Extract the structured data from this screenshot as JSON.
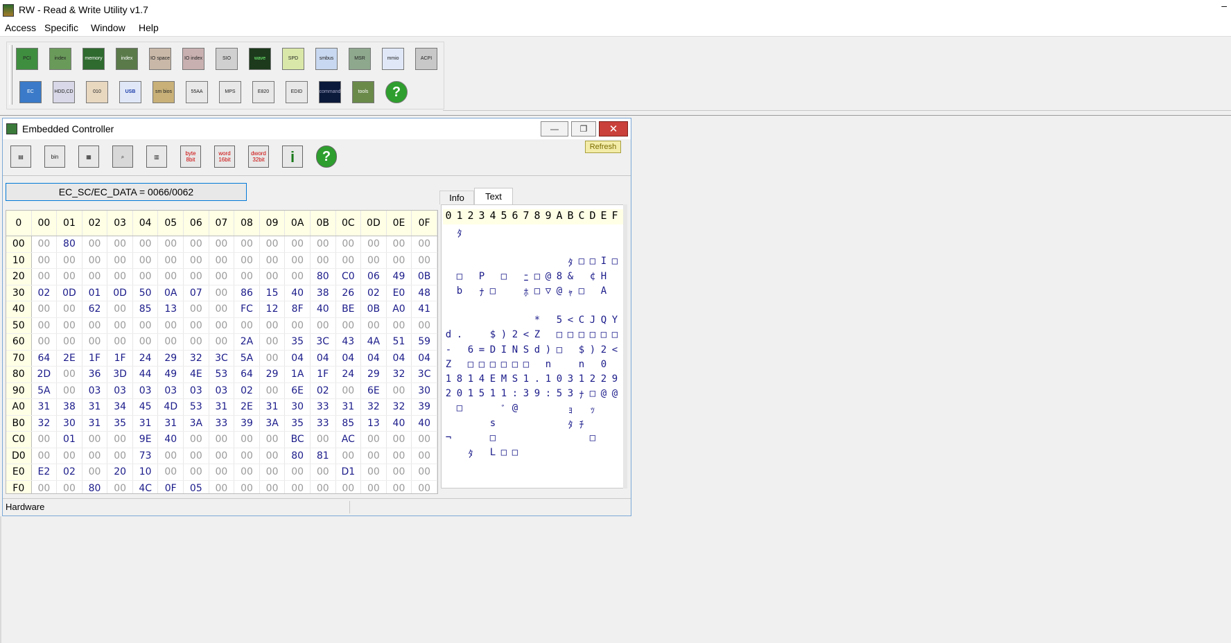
{
  "app": {
    "title": "RW - Read & Write Utility v1.7",
    "minimize_glyph": "–"
  },
  "menu": [
    "Access",
    "Specific",
    "Window",
    "Help"
  ],
  "toolbar": {
    "row1": [
      "PCI",
      "index",
      "memory",
      "index",
      "IO space",
      "IO index",
      "SIO",
      "wave",
      "SPD",
      "smbus",
      "MSR",
      "mmio",
      "ACPI"
    ],
    "row2": [
      "EC",
      "HDD,CD",
      "010",
      "USB",
      "sm bios",
      "55AA",
      "MPS",
      "E820",
      "EDID",
      "command",
      "tools",
      "help"
    ]
  },
  "ec_window": {
    "title": "Embedded Controller",
    "buttons": {
      "minimize": "—",
      "restore": "❐",
      "close": "✕"
    },
    "toolbar": [
      "save",
      "bin",
      "load",
      "find",
      "compare",
      "byte 8bit",
      "word 16bit",
      "dword 32bit",
      "info",
      "help"
    ],
    "refresh_label": "Refresh",
    "port_label": "EC_SC/EC_DATA = 0066/0062",
    "tabs": [
      "Info",
      "Text"
    ],
    "status_text": "Hardware",
    "hex": {
      "corner": "0",
      "columns": [
        "00",
        "01",
        "02",
        "03",
        "04",
        "05",
        "06",
        "07",
        "08",
        "09",
        "0A",
        "0B",
        "0C",
        "0D",
        "0E",
        "0F"
      ],
      "rows": [
        {
          "addr": "00",
          "cells": [
            "00",
            "80",
            "00",
            "00",
            "00",
            "00",
            "00",
            "00",
            "00",
            "00",
            "00",
            "00",
            "00",
            "00",
            "00",
            "00"
          ]
        },
        {
          "addr": "10",
          "cells": [
            "00",
            "00",
            "00",
            "00",
            "00",
            "00",
            "00",
            "00",
            "00",
            "00",
            "00",
            "00",
            "00",
            "00",
            "00",
            "00"
          ]
        },
        {
          "addr": "20",
          "cells": [
            "00",
            "00",
            "00",
            "00",
            "00",
            "00",
            "00",
            "00",
            "00",
            "00",
            "00",
            "80",
            "C0",
            "06",
            "49",
            "0B"
          ]
        },
        {
          "addr": "30",
          "cells": [
            "02",
            "0D",
            "01",
            "0D",
            "50",
            "0A",
            "07",
            "00",
            "86",
            "15",
            "40",
            "38",
            "26",
            "02",
            "E0",
            "48"
          ]
        },
        {
          "addr": "40",
          "cells": [
            "00",
            "00",
            "62",
            "00",
            "85",
            "13",
            "00",
            "00",
            "FC",
            "12",
            "8F",
            "40",
            "BE",
            "0B",
            "A0",
            "41"
          ]
        },
        {
          "addr": "50",
          "cells": [
            "00",
            "00",
            "00",
            "00",
            "00",
            "00",
            "00",
            "00",
            "00",
            "00",
            "00",
            "00",
            "00",
            "00",
            "00",
            "00"
          ]
        },
        {
          "addr": "60",
          "cells": [
            "00",
            "00",
            "00",
            "00",
            "00",
            "00",
            "00",
            "00",
            "2A",
            "00",
            "35",
            "3C",
            "43",
            "4A",
            "51",
            "59"
          ]
        },
        {
          "addr": "70",
          "cells": [
            "64",
            "2E",
            "1F",
            "1F",
            "24",
            "29",
            "32",
            "3C",
            "5A",
            "00",
            "04",
            "04",
            "04",
            "04",
            "04",
            "04"
          ]
        },
        {
          "addr": "80",
          "cells": [
            "2D",
            "00",
            "36",
            "3D",
            "44",
            "49",
            "4E",
            "53",
            "64",
            "29",
            "1A",
            "1F",
            "24",
            "29",
            "32",
            "3C"
          ]
        },
        {
          "addr": "90",
          "cells": [
            "5A",
            "00",
            "03",
            "03",
            "03",
            "03",
            "03",
            "03",
            "02",
            "00",
            "6E",
            "02",
            "00",
            "6E",
            "00",
            "30"
          ]
        },
        {
          "addr": "A0",
          "cells": [
            "31",
            "38",
            "31",
            "34",
            "45",
            "4D",
            "53",
            "31",
            "2E",
            "31",
            "30",
            "33",
            "31",
            "32",
            "32",
            "39"
          ]
        },
        {
          "addr": "B0",
          "cells": [
            "32",
            "30",
            "31",
            "35",
            "31",
            "31",
            "3A",
            "33",
            "39",
            "3A",
            "35",
            "33",
            "85",
            "13",
            "40",
            "40"
          ]
        },
        {
          "addr": "C0",
          "cells": [
            "00",
            "01",
            "00",
            "00",
            "9E",
            "40",
            "00",
            "00",
            "00",
            "00",
            "BC",
            "00",
            "AC",
            "00",
            "00",
            "00"
          ]
        },
        {
          "addr": "D0",
          "cells": [
            "00",
            "00",
            "00",
            "00",
            "73",
            "00",
            "00",
            "00",
            "00",
            "00",
            "80",
            "81",
            "00",
            "00",
            "00",
            "00"
          ]
        },
        {
          "addr": "E0",
          "cells": [
            "E2",
            "02",
            "00",
            "20",
            "10",
            "00",
            "00",
            "00",
            "00",
            "00",
            "00",
            "00",
            "D1",
            "00",
            "00",
            "00"
          ]
        },
        {
          "addr": "F0",
          "cells": [
            "00",
            "00",
            "80",
            "00",
            "4C",
            "0F",
            "05",
            "00",
            "00",
            "00",
            "00",
            "00",
            "00",
            "00",
            "00",
            "00"
          ]
        }
      ]
    },
    "text_view": {
      "ruler": [
        "0",
        "1",
        "2",
        "3",
        "4",
        "5",
        "6",
        "7",
        "8",
        "9",
        "A",
        "B",
        "C",
        "D",
        "E",
        "F"
      ],
      "lines": [
        [
          " ",
          "ﾀ",
          " ",
          " ",
          " ",
          " ",
          " ",
          " ",
          " ",
          " ",
          " ",
          " ",
          " ",
          " ",
          " ",
          " "
        ],
        [
          " ",
          " ",
          " ",
          " ",
          " ",
          " ",
          " ",
          " ",
          " ",
          " ",
          " ",
          " ",
          " ",
          " ",
          " ",
          " "
        ],
        [
          " ",
          " ",
          " ",
          " ",
          " ",
          " ",
          " ",
          " ",
          " ",
          " ",
          " ",
          "ﾀ",
          "□",
          "□",
          "I",
          "□"
        ],
        [
          " ",
          "□",
          " ",
          "P",
          " ",
          "□",
          " ",
          "ﾆ",
          "□",
          "@",
          "8",
          "&",
          " ",
          "¢",
          "H",
          " "
        ],
        [
          " ",
          "b",
          " ",
          "ﾅ",
          "□",
          " ",
          " ",
          "ﾎ",
          "□",
          "▽",
          "@",
          "ｬ",
          "□",
          " ",
          "A",
          " "
        ],
        [
          " ",
          " ",
          " ",
          " ",
          " ",
          " ",
          " ",
          " ",
          " ",
          " ",
          " ",
          " ",
          " ",
          " ",
          " ",
          " "
        ],
        [
          " ",
          " ",
          " ",
          " ",
          " ",
          " ",
          " ",
          " ",
          "*",
          " ",
          "5",
          "<",
          "C",
          "J",
          "Q",
          "Y"
        ],
        [
          "d",
          ".",
          " ",
          " ",
          "$",
          ")",
          "2",
          "<",
          "Z",
          " ",
          "□",
          "□",
          "□",
          "□",
          "□",
          "□"
        ],
        [
          "-",
          " ",
          "6",
          "=",
          "D",
          "I",
          "N",
          "S",
          "d",
          ")",
          "□",
          " ",
          "$",
          ")",
          "2",
          "<"
        ],
        [
          "Z",
          " ",
          "□",
          "□",
          "□",
          "□",
          "□",
          "□",
          " ",
          "n",
          " ",
          " ",
          "n",
          " ",
          "0",
          " "
        ],
        [
          "1",
          "8",
          "1",
          "4",
          "E",
          "M",
          "S",
          "1",
          ".",
          "1",
          "0",
          "3",
          "1",
          "2",
          "2",
          "9"
        ],
        [
          "2",
          "0",
          "1",
          "5",
          "1",
          "1",
          ":",
          "3",
          "9",
          ":",
          "5",
          "3",
          "ﾅ",
          "□",
          "@",
          "@"
        ],
        [
          " ",
          "□",
          " ",
          " ",
          " ",
          "ﾞ",
          "@",
          " ",
          " ",
          " ",
          " ",
          "ｮ",
          " ",
          "ｯ",
          " ",
          " "
        ],
        [
          " ",
          " ",
          " ",
          " ",
          "s",
          " ",
          " ",
          " ",
          " ",
          " ",
          " ",
          "ﾀ",
          "ﾁ",
          " ",
          " ",
          " "
        ],
        [
          "¬",
          " ",
          " ",
          " ",
          "□",
          " ",
          " ",
          " ",
          " ",
          " ",
          " ",
          " ",
          " ",
          "□",
          " ",
          " "
        ],
        [
          " ",
          " ",
          "ﾀ",
          " ",
          "L",
          "□",
          "□",
          " ",
          " ",
          " ",
          " ",
          " ",
          " ",
          " ",
          " ",
          " "
        ]
      ]
    }
  }
}
